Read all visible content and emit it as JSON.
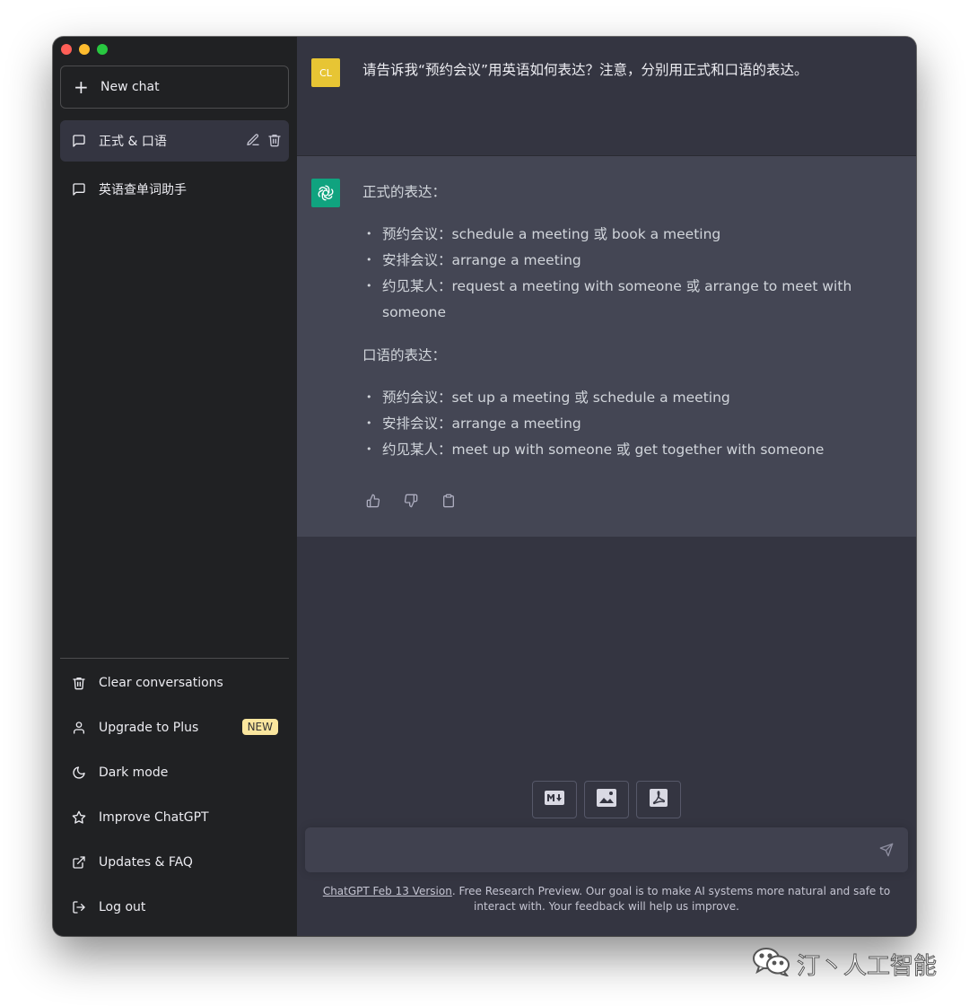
{
  "sidebar": {
    "new_chat": "New chat",
    "conversations": [
      {
        "title": "正式 & 口语",
        "active": true
      },
      {
        "title": "英语查单词助手",
        "active": false
      }
    ],
    "menu": {
      "clear": "Clear conversations",
      "upgrade": "Upgrade to Plus",
      "upgrade_badge": "NEW",
      "dark_mode": "Dark mode",
      "improve": "Improve ChatGPT",
      "updates": "Updates & FAQ",
      "logout": "Log out"
    }
  },
  "chat": {
    "user": {
      "avatar_initials": "CL",
      "message": "请告诉我“预约会议”用英语如何表达？注意，分别用正式和口语的表达。"
    },
    "assistant": {
      "formal_heading": "正式的表达：",
      "formal_items": [
        "预约会议：schedule a meeting 或 book a meeting",
        "安排会议：arrange a meeting",
        "约见某人：request a meeting with someone 或 arrange to meet with someone"
      ],
      "spoken_heading": "口语的表达：",
      "spoken_items": [
        "预约会议：set up a meeting 或 schedule a meeting",
        "安排会议：arrange a meeting",
        "约见某人：meet up with someone 或 get together with someone"
      ]
    }
  },
  "input": {
    "placeholder": ""
  },
  "footer": {
    "link": "ChatGPT Feb 13 Version",
    "text": ". Free Research Preview. Our goal is to make AI systems more natural and safe to interact with. Your feedback will help us improve."
  },
  "watermark": {
    "text": "汀丶人工智能"
  },
  "colors": {
    "sidebar_bg": "#202123",
    "main_bg": "#343541",
    "assistant_bg": "#444654",
    "user_avatar": "#e7c534",
    "bot_avatar": "#10a37f",
    "badge_bg": "#fae69e"
  },
  "icons": {
    "tool_buttons": [
      "markdown-export-icon",
      "image-export-icon",
      "pdf-export-icon"
    ]
  }
}
